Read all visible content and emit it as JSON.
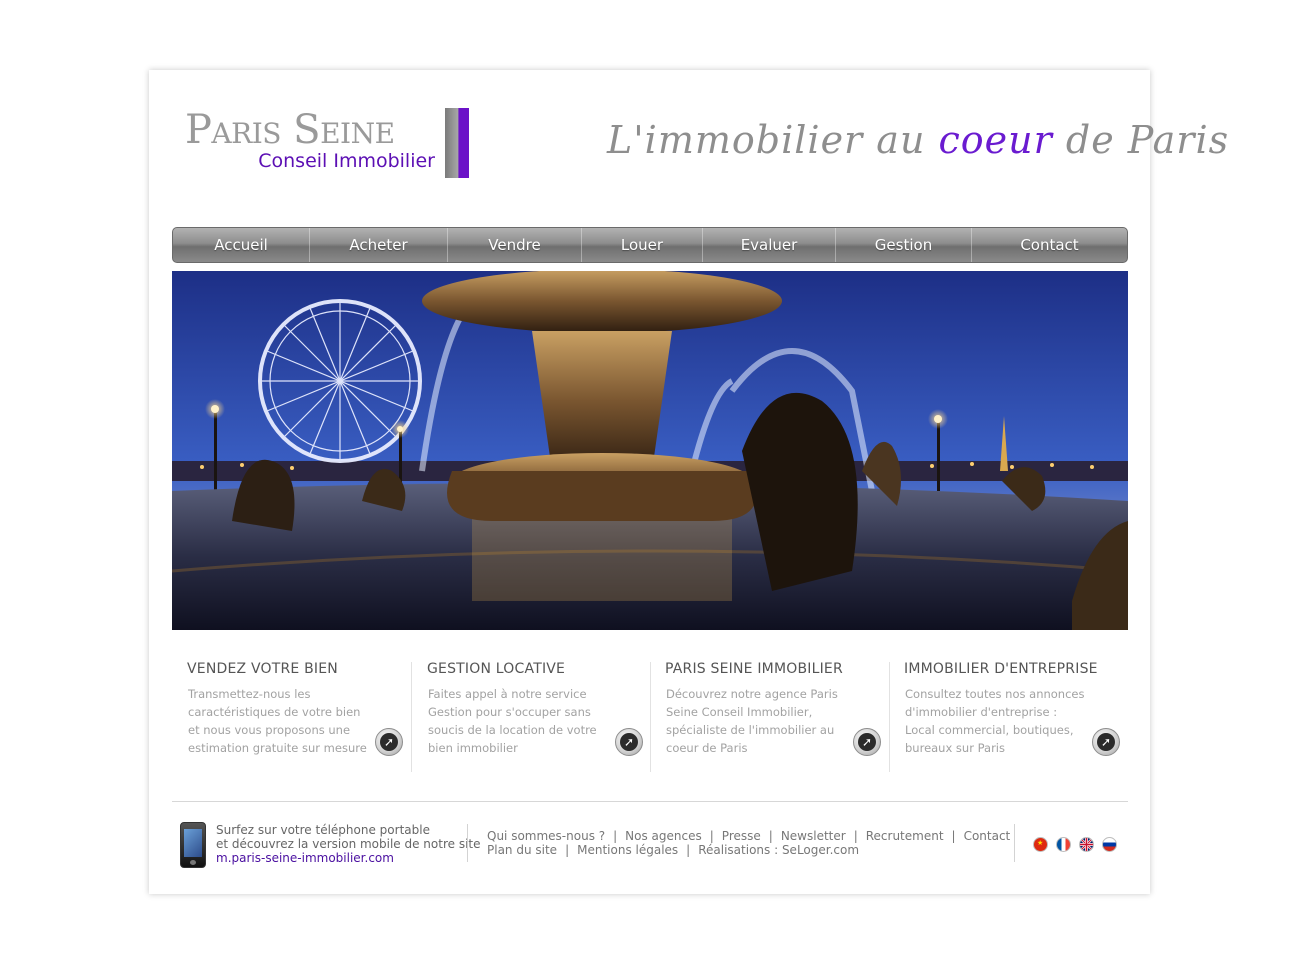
{
  "logo": {
    "title": "Paris Seine",
    "subtitle": "Conseil Immobilier"
  },
  "tagline": {
    "part1": "L'immobilier au ",
    "accent": "coeur",
    "part2": " de Paris"
  },
  "nav": [
    {
      "label": "Accueil"
    },
    {
      "label": "Acheter"
    },
    {
      "label": "Vendre"
    },
    {
      "label": "Louer"
    },
    {
      "label": "Evaluer"
    },
    {
      "label": "Gestion"
    },
    {
      "label": "Contact"
    }
  ],
  "blocks": [
    {
      "title": "VENDEZ VOTRE BIEN",
      "text": "Transmettez-nous les caractéristiques de votre bien et nous vous proposons une estimation gratuite sur mesure"
    },
    {
      "title": "GESTION LOCATIVE",
      "text": "Faites appel à notre service Gestion pour s'occuper sans soucis de la location de votre bien immobilier"
    },
    {
      "title": "PARIS SEINE IMMOBILIER",
      "text": "Découvrez notre agence Paris Seine Conseil Immobilier, spécialiste de l'immobilier au coeur de Paris"
    },
    {
      "title": "IMMOBILIER D'ENTREPRISE",
      "text": "Consultez toutes nos annonces d'immobilier d'entreprise : Local commercial, boutiques, bureaux sur Paris"
    }
  ],
  "footer": {
    "mobile_line1": "Surfez sur votre téléphone portable",
    "mobile_line2": "et découvrez la version mobile de notre site",
    "mobile_link": "m.paris-seine-immobilier.com",
    "links_row1": [
      "Qui sommes-nous ?",
      "Nos agences",
      "Presse",
      "Newsletter",
      "Recrutement",
      "Contact"
    ],
    "links_row2": [
      "Plan du site",
      "Mentions légales",
      "Réalisations : SeLoger.com"
    ],
    "flags": [
      "china-flag-icon",
      "france-flag-icon",
      "uk-flag-icon",
      "russia-flag-icon"
    ]
  },
  "colors": {
    "accent": "#5c0fb4",
    "nav": "#8d8d8d",
    "text_gray": "#a2a2a2"
  }
}
